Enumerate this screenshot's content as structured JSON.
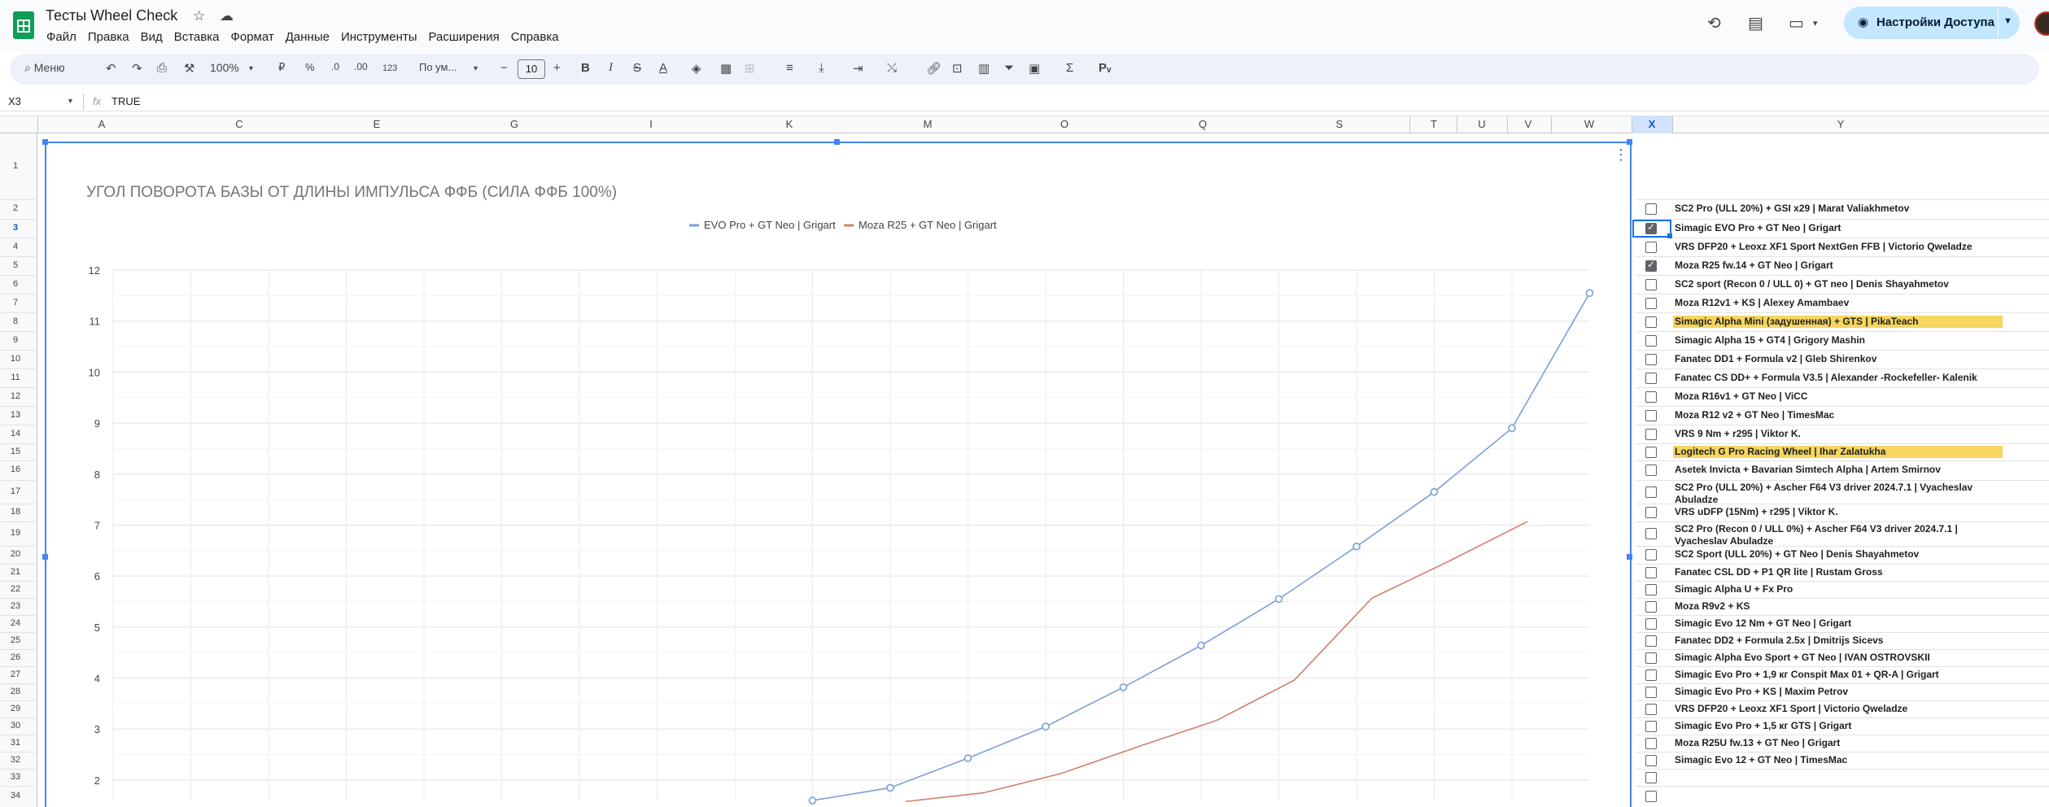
{
  "app": {
    "doc_title": "Тесты Wheel Check",
    "menu": [
      "Файл",
      "Правка",
      "Вид",
      "Вставка",
      "Формат",
      "Данные",
      "Инструменты",
      "Расширения",
      "Справка"
    ],
    "share_label": "Настройки Доступа"
  },
  "toolbar": {
    "search_label": "Меню",
    "zoom": "100%",
    "currency": "₽",
    "percent": "%",
    "dec_decrease": ".0",
    "dec_increase": ".00",
    "number_format": "123",
    "font_family": "По ум...",
    "font_size": "10",
    "minus": "−",
    "plus": "+"
  },
  "formula_bar": {
    "name_box": "X3",
    "fx": "fx",
    "value": "TRUE"
  },
  "columns": [
    "A",
    "C",
    "E",
    "G",
    "I",
    "K",
    "M",
    "O",
    "Q",
    "S",
    "T",
    "U",
    "V",
    "W",
    "X",
    "Y"
  ],
  "rows": [
    "1",
    "2",
    "3",
    "4",
    "5",
    "6",
    "7",
    "8",
    "9",
    "10",
    "11",
    "12",
    "13",
    "14",
    "15",
    "16",
    "17",
    "18",
    "19",
    "20",
    "21",
    "22",
    "23",
    "24",
    "25",
    "26",
    "27",
    "28",
    "29",
    "30",
    "31",
    "32",
    "33",
    "34"
  ],
  "chart_data": {
    "type": "line",
    "title": "УГОЛ ПОВОРОТА БАЗЫ ОТ ДЛИНЫ ИМПУЛЬСА ФФБ (СИЛА ФФБ 100%)",
    "y_ticks": [
      "2",
      "3",
      "4",
      "5",
      "6",
      "7",
      "8",
      "9",
      "10",
      "11",
      "12"
    ],
    "ylim": [
      1.6,
      12
    ],
    "x_count": 10,
    "grid": true,
    "legend_position": "top",
    "series": [
      {
        "name": "EVO Pro + GT Neo | Grigart",
        "color": "#7b9fd8",
        "markers": true,
        "values": [
          1.6,
          1.85,
          2.43,
          3.05,
          3.82,
          4.64,
          5.55,
          6.58,
          7.65,
          8.9,
          11.55
        ]
      },
      {
        "name": "Moza R25 + GT Neo | Grigart",
        "color": "#d0806e",
        "markers": false,
        "values": [
          1.58,
          1.75,
          2.13,
          2.66,
          3.17,
          3.96,
          5.57,
          6.3,
          7.07
        ]
      }
    ]
  },
  "checklist": [
    {
      "label": "SC2 Pro (ULL 20%) + GSI x29 | Marat Valiakhmetov",
      "checked": false,
      "hl": false
    },
    {
      "label": "Simagic EVO Pro + GT Neo | Grigart",
      "checked": true,
      "hl": false
    },
    {
      "label": "VRS DFP20 + Leoxz XF1 Sport NextGen FFB | Victorio Qweladze",
      "checked": false,
      "hl": false
    },
    {
      "label": "Moza R25 fw.14 + GT Neo | Grigart",
      "checked": true,
      "hl": false
    },
    {
      "label": "SC2 sport (Recon 0 / ULL 0) + GT neo | Denis Shayahmetov",
      "checked": false,
      "hl": false
    },
    {
      "label": "Moza R12v1 + KS | Alexey Amambaev",
      "checked": false,
      "hl": false
    },
    {
      "label": "Simagic Alpha Mini (задушенная) + GTS | PikaTeach",
      "checked": false,
      "hl": true
    },
    {
      "label": "Simagic Alpha 15 + GT4 | Grigory Mashin",
      "checked": false,
      "hl": false
    },
    {
      "label": "Fanatec DD1 + Formula v2 | Gleb Shirenkov",
      "checked": false,
      "hl": false
    },
    {
      "label": "Fanatec CS DD+ + Formula V3.5 | Alexander -Rockefeller- Kalenik",
      "checked": false,
      "hl": false
    },
    {
      "label": "Moza R16v1 + GT Neo | ViCC",
      "checked": false,
      "hl": false
    },
    {
      "label": "Moza R12 v2 + GT Neo | TimesMac",
      "checked": false,
      "hl": false
    },
    {
      "label": "VRS 9 Nm + r295 | Viktor K.",
      "checked": false,
      "hl": false
    },
    {
      "label": "Logitech G Pro Racing Wheel | Ihar Zalatukha",
      "checked": false,
      "hl": true
    },
    {
      "label": "Asetek Invicta + Bavarian Simtech Alpha | Artem Smirnov",
      "checked": false,
      "hl": false
    },
    {
      "label": "SC2 Pro (ULL 20%) + Ascher F64 V3 driver 2024.7.1 | Vyacheslav Abuladze",
      "checked": false,
      "hl": false
    },
    {
      "label": "VRS uDFP (15Nm) + r295 | Viktor K.",
      "checked": false,
      "hl": false
    },
    {
      "label": "SC2 Pro (Recon 0 / ULL 0%) + Ascher F64 V3 driver 2024.7.1 | Vyacheslav Abuladze",
      "checked": false,
      "hl": false
    },
    {
      "label": "SC2 Sport (ULL 20%) + GT Neo | Denis Shayahmetov",
      "checked": false,
      "hl": false
    },
    {
      "label": "Fanatec CSL DD + P1 QR lite | Rustam Gross",
      "checked": false,
      "hl": false
    },
    {
      "label": "Simagic Alpha U + Fx Pro",
      "checked": false,
      "hl": false
    },
    {
      "label": "Moza R9v2 + KS",
      "checked": false,
      "hl": false
    },
    {
      "label": "Simagic Evo 12 Nm + GT Neo | Grigart",
      "checked": false,
      "hl": false
    },
    {
      "label": "Fanatec DD2 + Formula 2.5x | Dmitrijs Sicevs",
      "checked": false,
      "hl": false
    },
    {
      "label": "Simagic Alpha Evo Sport + GT Neo | IVAN OSTROVSKII",
      "checked": false,
      "hl": false
    },
    {
      "label": "Simagic Evo Pro + 1,9 кг Conspit Max 01 + QR-A | Grigart",
      "checked": false,
      "hl": false
    },
    {
      "label": "Simagic Evo Pro + KS | Maxim Petrov",
      "checked": false,
      "hl": false
    },
    {
      "label": "VRS DFP20 + Leoxz XF1 Sport | Victorio Qweladze",
      "checked": false,
      "hl": false
    },
    {
      "label": "Simagic Evo Pro + 1,5 кг GTS | Grigart",
      "checked": false,
      "hl": false
    },
    {
      "label": "Moza R25U fw.13 + GT Neo | Grigart",
      "checked": false,
      "hl": false
    },
    {
      "label": "Simagic Evo 12 + GT Neo | TimesMac",
      "checked": false,
      "hl": false
    },
    {
      "label": "",
      "checked": false,
      "hl": false
    },
    {
      "label": "",
      "checked": false,
      "hl": false
    }
  ]
}
